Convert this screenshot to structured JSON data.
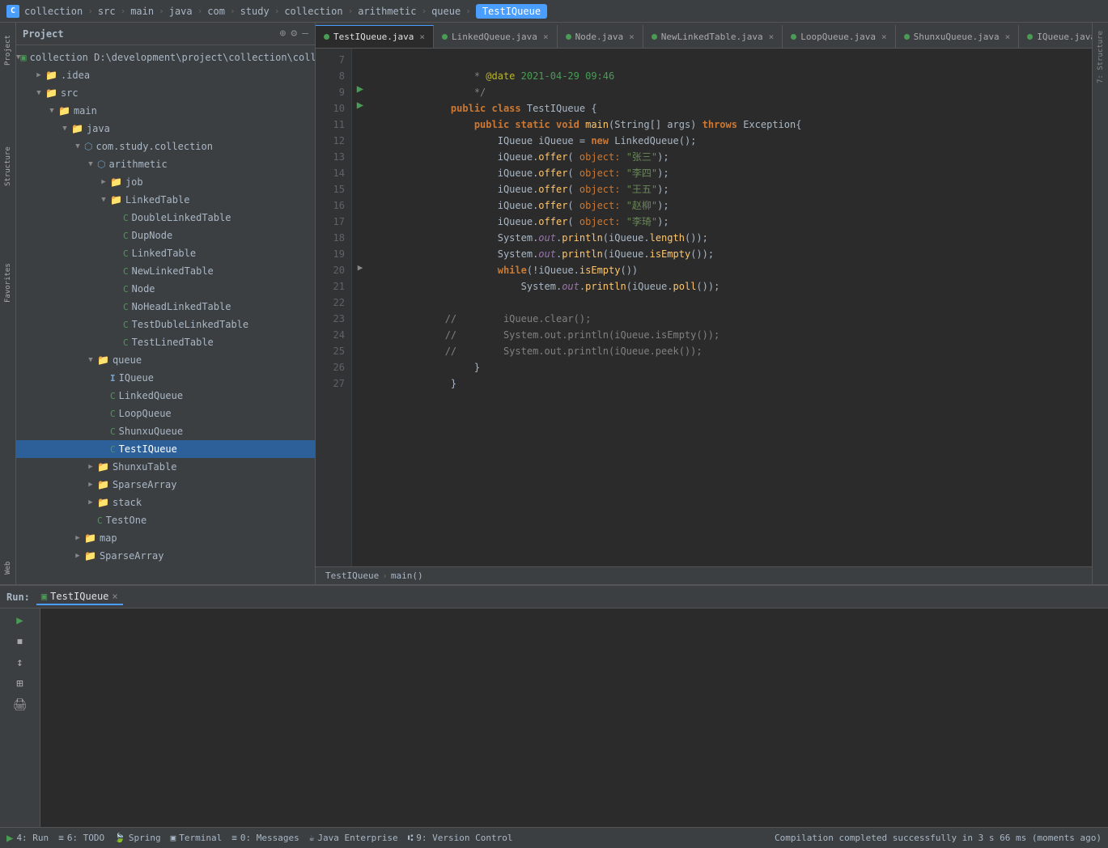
{
  "topBar": {
    "icon": "C",
    "breadcrumbs": [
      "collection",
      "src",
      "main",
      "java",
      "com",
      "study",
      "collection",
      "arithmetic",
      "queue",
      "TestIQueue"
    ]
  },
  "projectPanel": {
    "title": "Project",
    "tree": [
      {
        "id": "collection",
        "label": "collection D:\\development\\project\\collection\\collection",
        "indent": 0,
        "type": "project",
        "expanded": true
      },
      {
        "id": "idea",
        "label": ".idea",
        "indent": 1,
        "type": "folder",
        "expanded": false
      },
      {
        "id": "src",
        "label": "src",
        "indent": 1,
        "type": "folder",
        "expanded": true
      },
      {
        "id": "main",
        "label": "main",
        "indent": 2,
        "type": "folder",
        "expanded": true
      },
      {
        "id": "java",
        "label": "java",
        "indent": 3,
        "type": "folder",
        "expanded": true
      },
      {
        "id": "com-study-collection",
        "label": "com.study.collection",
        "indent": 4,
        "type": "package",
        "expanded": true
      },
      {
        "id": "arithmetic",
        "label": "arithmetic",
        "indent": 5,
        "type": "package",
        "expanded": true
      },
      {
        "id": "job",
        "label": "job",
        "indent": 6,
        "type": "folder",
        "expanded": false
      },
      {
        "id": "LinkedTable",
        "label": "LinkedTable",
        "indent": 6,
        "type": "folder",
        "expanded": true
      },
      {
        "id": "DoubleLinkedTable",
        "label": "DoubleLinkedTable",
        "indent": 7,
        "type": "class-g",
        "expanded": false
      },
      {
        "id": "DupNode",
        "label": "DupNode",
        "indent": 7,
        "type": "class-g",
        "expanded": false
      },
      {
        "id": "LinkedTable2",
        "label": "LinkedTable",
        "indent": 7,
        "type": "class-g",
        "expanded": false
      },
      {
        "id": "NewLinkedTable",
        "label": "NewLinkedTable",
        "indent": 7,
        "type": "class-g",
        "expanded": false
      },
      {
        "id": "Node",
        "label": "Node",
        "indent": 7,
        "type": "class-g",
        "expanded": false
      },
      {
        "id": "NoHeadLinkedTable",
        "label": "NoHeadLinkedTable",
        "indent": 7,
        "type": "class-g",
        "expanded": false
      },
      {
        "id": "TestDubleLinkedTable",
        "label": "TestDubleLinkedTable",
        "indent": 7,
        "type": "class-g",
        "expanded": false
      },
      {
        "id": "TestLinedTable",
        "label": "TestLinedTable",
        "indent": 7,
        "type": "class-g",
        "expanded": false
      },
      {
        "id": "queue",
        "label": "queue",
        "indent": 5,
        "type": "folder",
        "expanded": true
      },
      {
        "id": "IQueue",
        "label": "IQueue",
        "indent": 6,
        "type": "class-i",
        "expanded": false
      },
      {
        "id": "LinkedQueue",
        "label": "LinkedQueue",
        "indent": 6,
        "type": "class-g",
        "expanded": false
      },
      {
        "id": "LoopQueue",
        "label": "LoopQueue",
        "indent": 6,
        "type": "class-g",
        "expanded": false
      },
      {
        "id": "ShunxuQueue",
        "label": "ShunxuQueue",
        "indent": 6,
        "type": "class-g",
        "expanded": false
      },
      {
        "id": "TestIQueue",
        "label": "TestIQueue",
        "indent": 6,
        "type": "class-g",
        "expanded": false,
        "selected": true
      },
      {
        "id": "ShunxuTable",
        "label": "ShunxuTable",
        "indent": 5,
        "type": "folder",
        "expanded": false
      },
      {
        "id": "SparseArray",
        "label": "SparseArray",
        "indent": 5,
        "type": "folder",
        "expanded": false
      },
      {
        "id": "stack",
        "label": "stack",
        "indent": 5,
        "type": "folder",
        "expanded": false
      },
      {
        "id": "TestOne",
        "label": "TestOne",
        "indent": 5,
        "type": "class-g",
        "expanded": false
      },
      {
        "id": "map",
        "label": "map",
        "indent": 4,
        "type": "folder",
        "expanded": false
      },
      {
        "id": "SparseArray2",
        "label": "SparseArray",
        "indent": 4,
        "type": "folder",
        "expanded": false
      }
    ]
  },
  "editorTabs": [
    {
      "id": "TestIQueue",
      "label": "TestIQueue.java",
      "active": true,
      "dotType": "green"
    },
    {
      "id": "LinkedQueue",
      "label": "LinkedQueue.java",
      "active": false,
      "dotType": "green"
    },
    {
      "id": "Node",
      "label": "Node.java",
      "active": false,
      "dotType": "green"
    },
    {
      "id": "NewLinkedTable",
      "label": "NewLinkedTable.java",
      "active": false,
      "dotType": "green"
    },
    {
      "id": "LoopQueue",
      "label": "LoopQueue.java",
      "active": false,
      "dotType": "green"
    },
    {
      "id": "ShunxuQueue",
      "label": "ShunxuQueue.java",
      "active": false,
      "dotType": "green"
    },
    {
      "id": "IQueue",
      "label": "IQueue.java",
      "active": false,
      "dotType": "green"
    }
  ],
  "codeLines": [
    {
      "num": 7,
      "content": "     * @date 2021-04-29 09:46",
      "hasRun": false
    },
    {
      "num": 8,
      "content": "     */",
      "hasRun": false
    },
    {
      "num": 9,
      "content": " public class TestIQueue {",
      "hasRun": true
    },
    {
      "num": 10,
      "content": "     public static void main(String[] args) throws Exception{",
      "hasRun": true
    },
    {
      "num": 11,
      "content": "         IQueue iQueue = new LinkedQueue();",
      "hasRun": false
    },
    {
      "num": 12,
      "content": "         iQueue.offer( object: \"张三\");",
      "hasRun": false
    },
    {
      "num": 13,
      "content": "         iQueue.offer( object: \"李四\");",
      "hasRun": false
    },
    {
      "num": 14,
      "content": "         iQueue.offer( object: \"王五\");",
      "hasRun": false
    },
    {
      "num": 15,
      "content": "         iQueue.offer( object: \"赵柳\");",
      "hasRun": false
    },
    {
      "num": 16,
      "content": "         iQueue.offer( object: \"李琦\");",
      "hasRun": false
    },
    {
      "num": 17,
      "content": "         System.out.println(iQueue.length());",
      "hasRun": false
    },
    {
      "num": 18,
      "content": "         System.out.println(iQueue.isEmpty());",
      "hasRun": false
    },
    {
      "num": 19,
      "content": "         while(!iQueue.isEmpty())",
      "hasRun": false
    },
    {
      "num": 20,
      "content": "             System.out.println(iQueue.poll());",
      "hasRun": false
    },
    {
      "num": 21,
      "content": "",
      "hasRun": false
    },
    {
      "num": 22,
      "content": "//        iQueue.clear();",
      "hasRun": false
    },
    {
      "num": 23,
      "content": "//        System.out.println(iQueue.isEmpty());",
      "hasRun": false
    },
    {
      "num": 24,
      "content": "//        System.out.println(iQueue.peek());",
      "hasRun": false
    },
    {
      "num": 25,
      "content": "     }",
      "hasRun": false
    },
    {
      "num": 26,
      "content": " }",
      "hasRun": false
    },
    {
      "num": 27,
      "content": "",
      "hasRun": false
    }
  ],
  "breadcrumbBar": {
    "file": "TestIQueue",
    "method": "main()"
  },
  "bottomPanel": {
    "runLabel": "Run:",
    "activeTab": "TestIQueue",
    "tabs": [
      {
        "label": "TestIQueue",
        "active": true
      }
    ],
    "toolbar": {
      "buttons": [
        {
          "icon": "▶",
          "name": "run",
          "active": true
        },
        {
          "icon": "⏹",
          "name": "stop",
          "active": false
        },
        {
          "icon": "↕",
          "name": "scroll-to-end",
          "active": false
        },
        {
          "icon": "⊞",
          "name": "expand",
          "active": false
        },
        {
          "icon": "🖨",
          "name": "print",
          "active": false
        }
      ]
    }
  },
  "statusBar": {
    "items": [
      {
        "icon": "▶",
        "label": "4: Run",
        "name": "run-status"
      },
      {
        "icon": "≡",
        "label": "6: TODO",
        "name": "todo-status"
      },
      {
        "icon": "🍃",
        "label": "Spring",
        "name": "spring-status"
      },
      {
        "icon": "▣",
        "label": "Terminal",
        "name": "terminal-status"
      },
      {
        "icon": "≡",
        "label": "0: Messages",
        "name": "messages-status"
      },
      {
        "icon": "☕",
        "label": "Java Enterprise",
        "name": "java-enterprise-status"
      },
      {
        "icon": "⑆",
        "label": "9: Version Control",
        "name": "version-control-status"
      }
    ],
    "message": "Compilation completed successfully in 3 s 66 ms (moments ago)"
  }
}
